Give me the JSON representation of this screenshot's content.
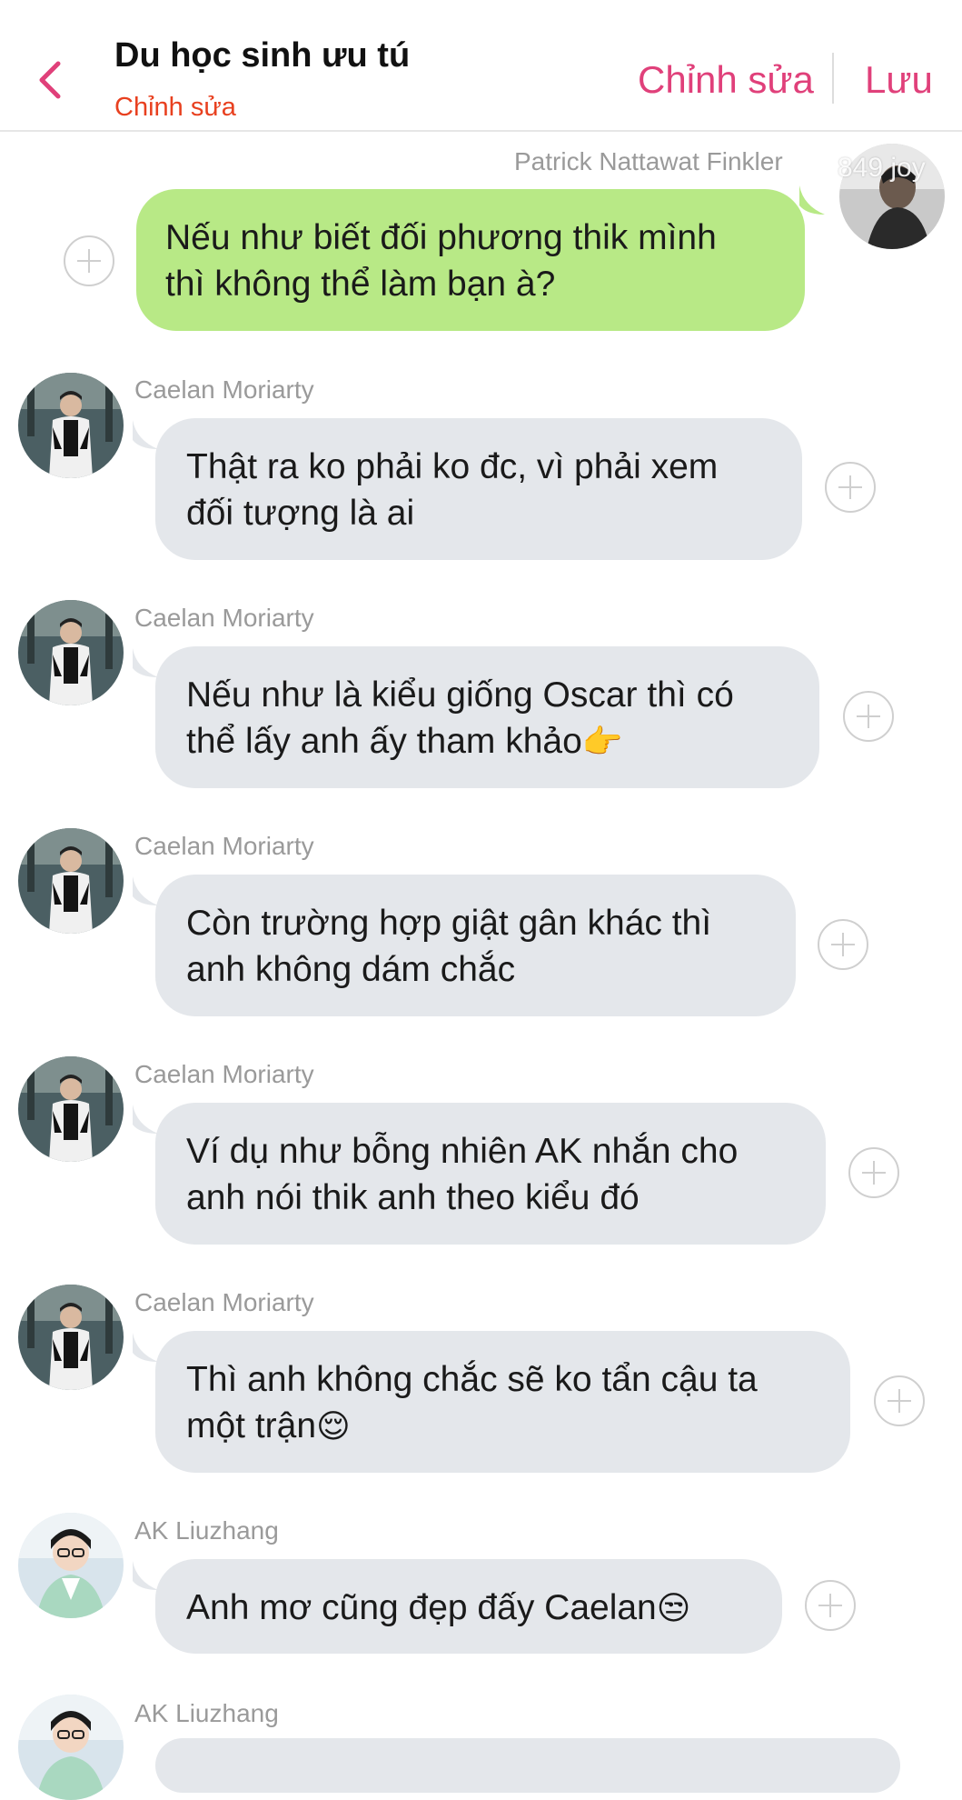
{
  "header": {
    "title": "Du học sinh ưu tú",
    "subtitle": "Chỉnh sửa",
    "edit_label": "Chỉnh sửa",
    "save_label": "Lưu",
    "accent_color": "#e0407a"
  },
  "watermark": "849 joy",
  "messages": [
    {
      "sender": "Patrick Nattawat Finkler",
      "side": "right",
      "lines": [
        "Nếu như biết đối phương thik mình",
        "thì không thể làm bạn à?"
      ]
    },
    {
      "sender": "Caelan Moriarty",
      "side": "left",
      "lines": [
        "Thật ra ko phải ko đc, vì phải xem",
        "đối tượng là ai"
      ]
    },
    {
      "sender": "Caelan Moriarty",
      "side": "left",
      "lines": [
        "Nếu như là kiểu giống Oscar thì có",
        "thể lấy anh ấy tham khảo"
      ],
      "emoji": "👉"
    },
    {
      "sender": "Caelan Moriarty",
      "side": "left",
      "lines": [
        "Còn trường hợp giật gân khác thì",
        "anh không dám chắc"
      ]
    },
    {
      "sender": "Caelan Moriarty",
      "side": "left",
      "lines": [
        "Ví dụ như bỗng nhiên AK nhắn cho",
        "anh nói thik anh theo kiểu đó"
      ]
    },
    {
      "sender": "Caelan Moriarty",
      "side": "left",
      "lines": [
        "Thì anh không chắc sẽ ko tẩn cậu ta",
        "một trận"
      ],
      "emoji": "😌"
    },
    {
      "sender": "AK Liuzhang",
      "side": "left",
      "lines": [
        "Anh mơ cũng đẹp đấy Caelan"
      ],
      "emoji": "😒"
    },
    {
      "sender": "AK Liuzhang",
      "side": "left",
      "lines": []
    }
  ]
}
